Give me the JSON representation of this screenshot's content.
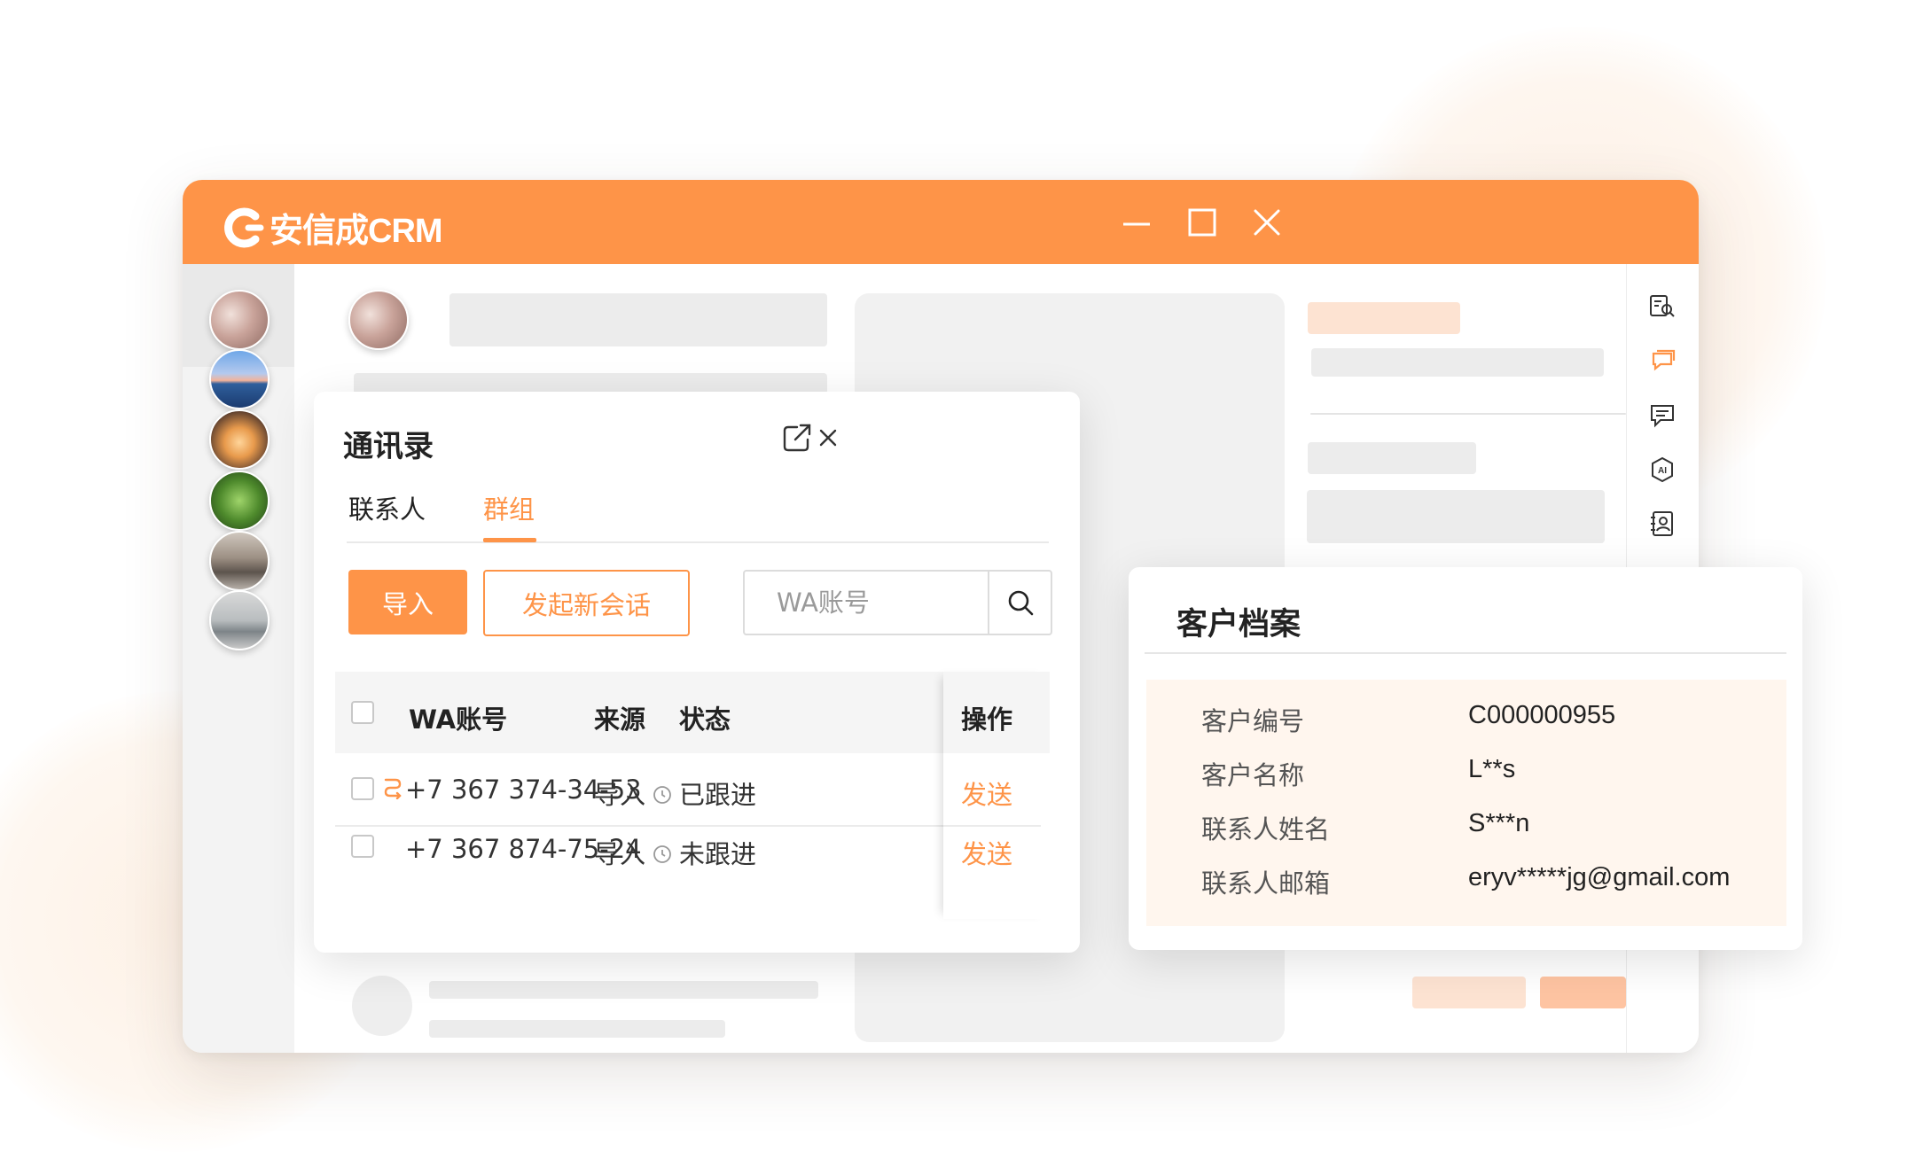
{
  "app": {
    "title": "安信成CRM"
  },
  "window_controls": {
    "minimize_icon": "minimize-icon",
    "maximize_icon": "maximize-icon",
    "close_icon": "close-icon"
  },
  "left_sidebar": {
    "avatars": [
      {
        "name": "chat-avatar-interior-1"
      },
      {
        "name": "chat-avatar-sea-sunset"
      },
      {
        "name": "chat-avatar-dolphin"
      },
      {
        "name": "chat-avatar-plant"
      },
      {
        "name": "chat-avatar-living-room"
      },
      {
        "name": "chat-avatar-sofa"
      }
    ]
  },
  "right_sidebar": {
    "icons": [
      "customer-search-icon",
      "chat-bubbles-icon",
      "message-icon",
      "ai-icon",
      "contact-card-icon"
    ],
    "active": "chat-bubbles-icon"
  },
  "contacts_panel": {
    "title": "通讯录",
    "tabs": [
      {
        "label": "联系人",
        "active": false
      },
      {
        "label": "群组",
        "active": true
      }
    ],
    "import_button": "导入",
    "new_chat_button": "发起新会话",
    "search": {
      "placeholder": "WA账号",
      "value": ""
    },
    "columns": {
      "wa_account": "WA账号",
      "source": "来源",
      "status": "状态",
      "action": "操作"
    },
    "rows": [
      {
        "wa_account": "+7 367 374-34-53",
        "source": "导入",
        "status": "已跟进",
        "action": "发送",
        "linked": true
      },
      {
        "wa_account": "+7 367 874-75-24",
        "source": "导入",
        "status": "未跟进",
        "action": "发送",
        "linked": false
      }
    ]
  },
  "customer_profile": {
    "title": "客户档案",
    "fields": [
      {
        "label": "客户编号",
        "value": "C000000955"
      },
      {
        "label": "客户名称",
        "value": "L**s"
      },
      {
        "label": "联系人姓名",
        "value": "S***n"
      },
      {
        "label": "联系人邮箱",
        "value": "eryv*****jg@gmail.com"
      }
    ]
  },
  "colors": {
    "accent": "#fe9448",
    "profile_bg": "#fff6ee",
    "sidebar_bg": "#f3f3f3"
  }
}
